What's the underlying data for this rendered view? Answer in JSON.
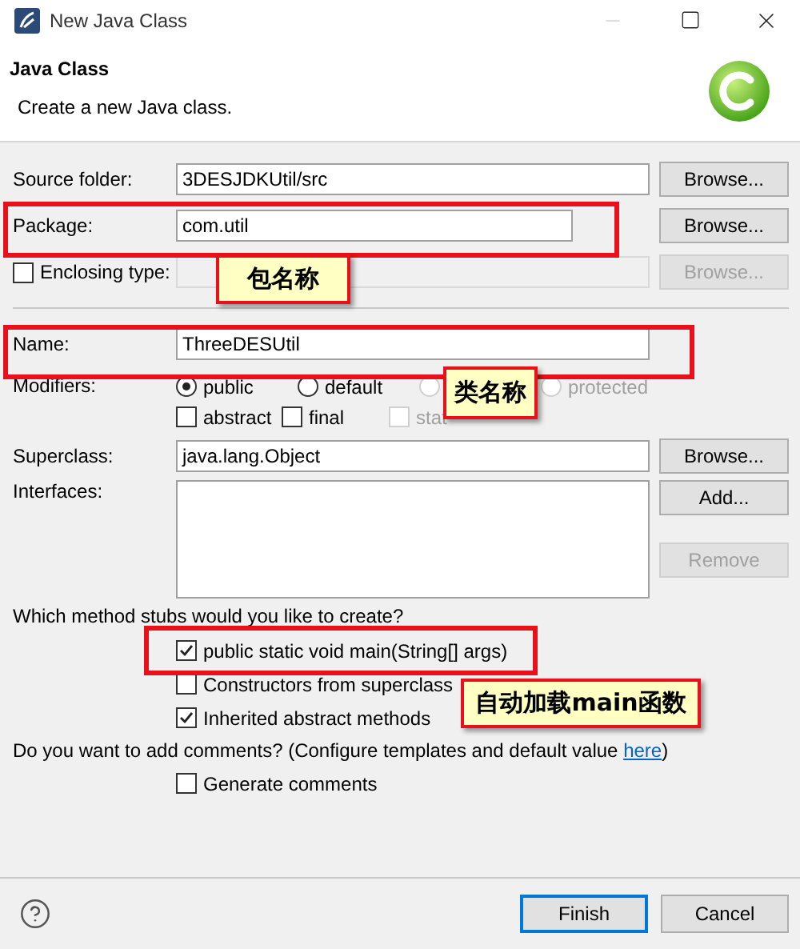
{
  "window": {
    "title": "New Java Class"
  },
  "header": {
    "title": "Java Class",
    "message": "Create a new Java class."
  },
  "source_folder": {
    "label": "Source folder:",
    "value": "3DESJDKUtil/src",
    "button": "Browse...",
    "button_disabled": false
  },
  "package": {
    "label": "Package:",
    "value": "com.util",
    "button": "Browse...",
    "button_disabled": false
  },
  "enclosing_type": {
    "label": "Enclosing type:",
    "checked": false,
    "value_disabled": true,
    "button": "Browse...",
    "button_disabled": true
  },
  "name": {
    "label": "Name:",
    "value": "ThreeDESUtil"
  },
  "modifiers": {
    "label": "Modifiers:",
    "access": [
      {
        "label": "public",
        "selected": true,
        "disabled": false
      },
      {
        "label": "default",
        "selected": false,
        "disabled": false
      },
      {
        "selected": false,
        "disabled": true
      },
      {
        "label": "protected",
        "selected": false,
        "disabled": true
      }
    ],
    "flags": [
      {
        "label": "abstract",
        "checked": false,
        "disabled": false
      },
      {
        "label": "final",
        "checked": false,
        "disabled": false
      },
      {
        "label": "stat",
        "checked": false,
        "disabled": true
      }
    ]
  },
  "superclass": {
    "label": "Superclass:",
    "value": "java.lang.Object",
    "button": "Browse..."
  },
  "interfaces": {
    "label": "Interfaces:",
    "buttons": [
      {
        "label": "Add...",
        "disabled": false
      },
      {
        "label": "Remove",
        "disabled": true
      }
    ]
  },
  "stubs": {
    "question": "Which method stubs would you like to create?",
    "options": [
      {
        "label": "public static void main(String[] args)",
        "checked": true
      },
      {
        "label": "Constructors from superclass",
        "checked": false
      },
      {
        "label": "Inherited abstract methods",
        "checked": true
      }
    ]
  },
  "comments": {
    "before": "Do you want to add comments? (Configure templates and default value ",
    "link": "here",
    "after": ")",
    "options": [
      {
        "label": "Generate comments",
        "checked": false
      }
    ]
  },
  "buttons": [
    {
      "label": "Finish",
      "default": true
    },
    {
      "label": "Cancel",
      "default": false
    }
  ],
  "callouts": [
    {
      "text": "包名称"
    },
    {
      "text": "类名称"
    },
    {
      "text": "自动加载main函数"
    }
  ]
}
